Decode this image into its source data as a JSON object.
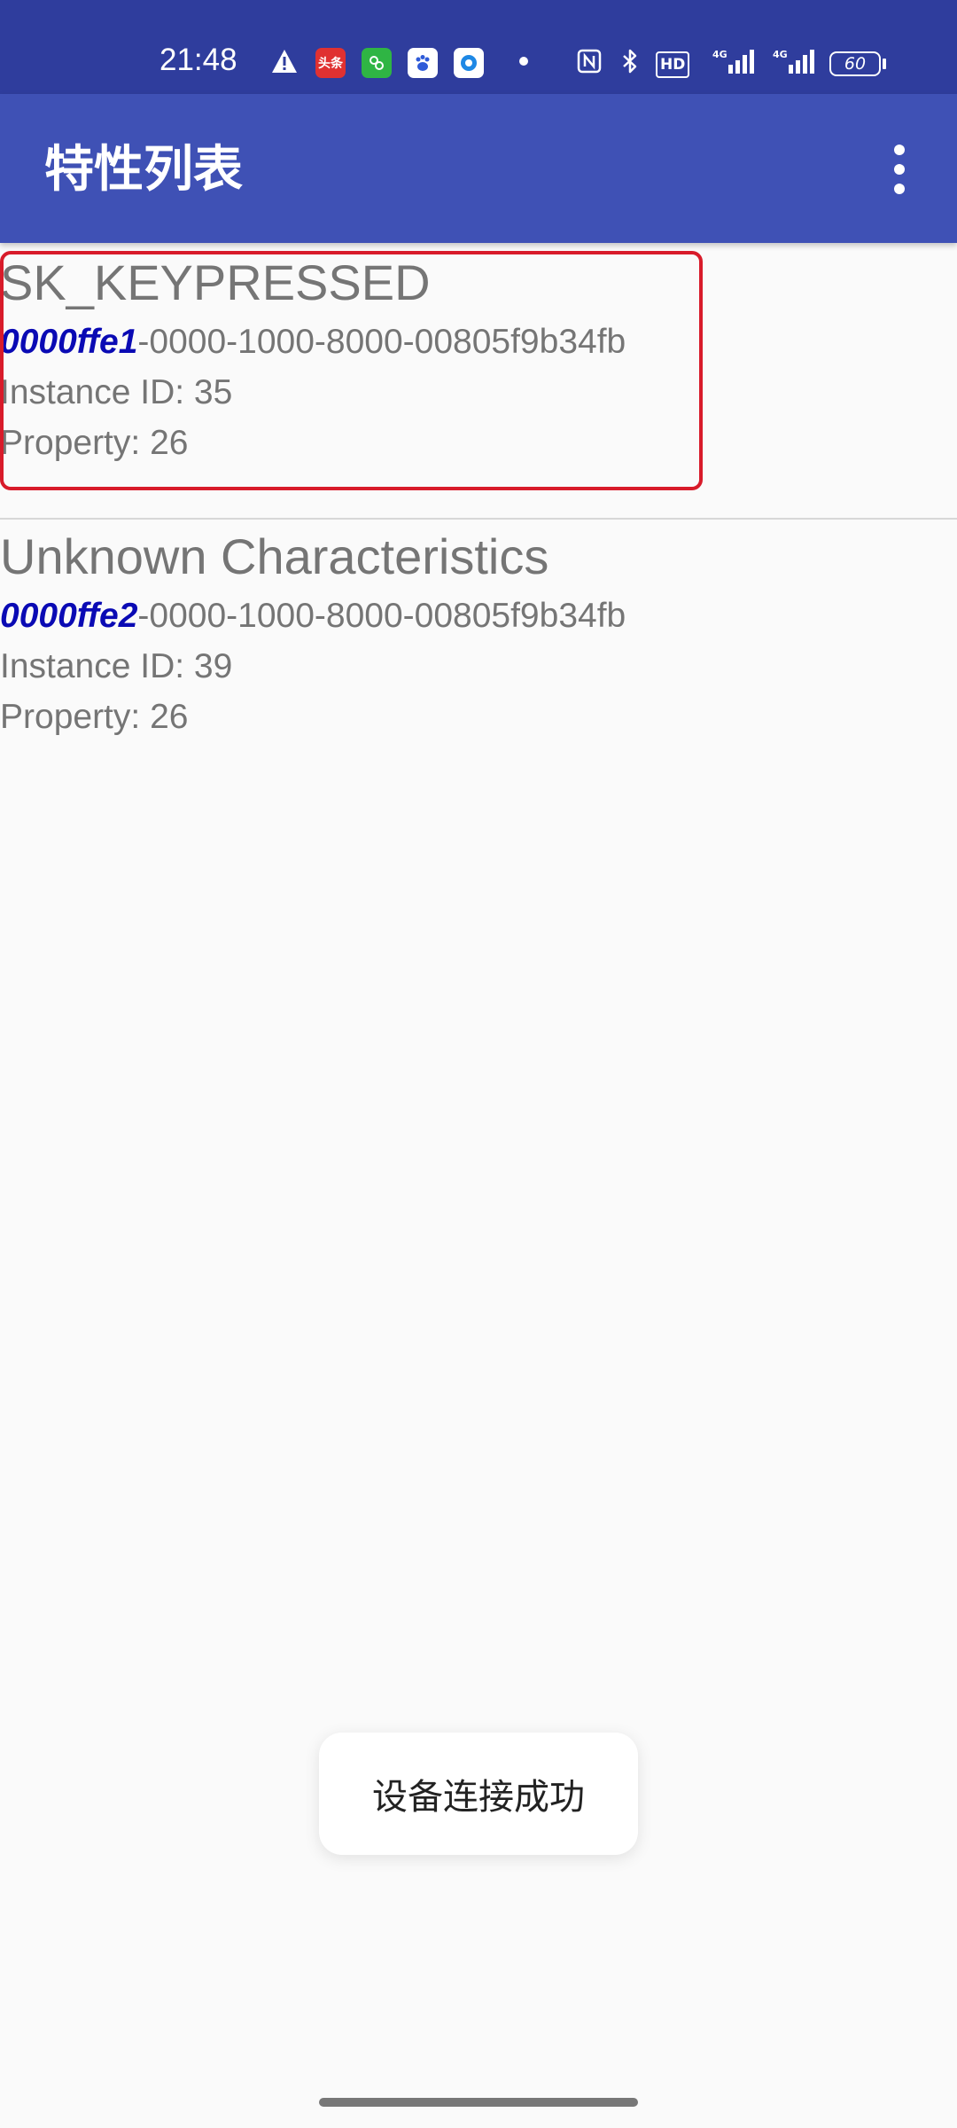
{
  "status_bar": {
    "time": "21:48",
    "battery": "60",
    "app_icons": [
      "warning-icon",
      "toutiao-app-icon",
      "wechat-miniapp-icon",
      "baidu-app-icon",
      "circle-app-icon"
    ],
    "indicators": [
      "nfc-icon",
      "bluetooth-icon",
      "hd-icon",
      "4g-signal-icon",
      "4g-signal-icon"
    ],
    "toutiao_label": "头条",
    "hd_label": "HD",
    "net_label_1": "4G",
    "net_label_2": "4G"
  },
  "app_bar": {
    "title": "特性列表",
    "menu_icon": "more-vert-icon"
  },
  "characteristics": [
    {
      "name": "SK_KEYPRESSED",
      "uuid_prefix": "0000ffe1",
      "uuid_suffix": "-0000-1000-8000-00805f9b34fb",
      "instance_id": "Instance ID: 35",
      "property": "Property: 26"
    },
    {
      "name": "Unknown Characteristics",
      "uuid_prefix": "0000ffe2",
      "uuid_suffix": "-0000-1000-8000-00805f9b34fb",
      "instance_id": "Instance ID: 39",
      "property": "Property: 26"
    }
  ],
  "toast": {
    "message": "设备连接成功"
  },
  "colors": {
    "status_bar": "#2f3d9d",
    "app_bar": "#3f51b5",
    "uuid_prefix": "#0a0ab4",
    "text_secondary": "#757575",
    "highlight": "#d81b2a",
    "background": "#fafafa"
  }
}
